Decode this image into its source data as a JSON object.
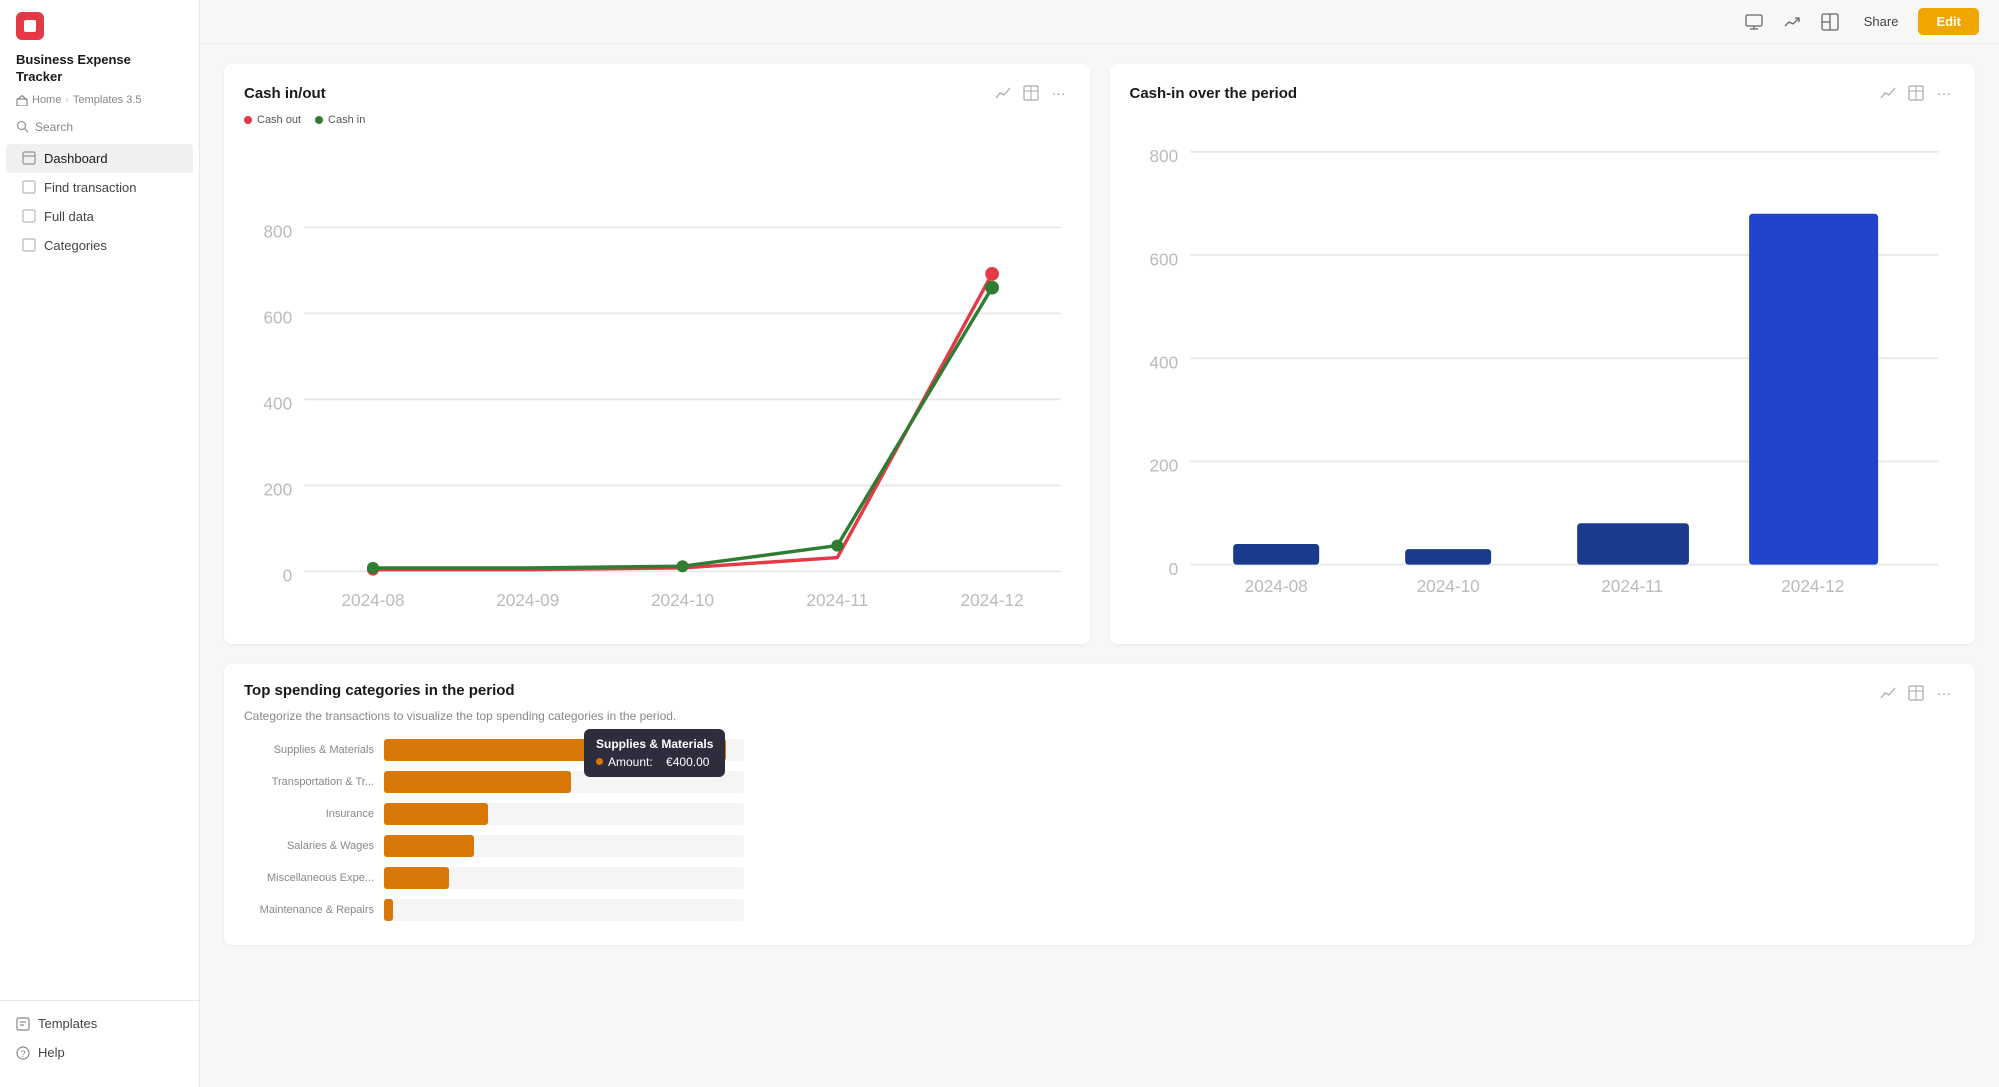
{
  "sidebar": {
    "app_title_line1": "Business Expense",
    "app_title_line2": "Tracker",
    "breadcrumb": {
      "home": "Home",
      "separator": "Templates 3.5"
    },
    "search_label": "Search",
    "nav_items": [
      {
        "id": "dashboard",
        "label": "Dashboard",
        "active": true
      },
      {
        "id": "find-transaction",
        "label": "Find transaction",
        "active": false
      },
      {
        "id": "full-data",
        "label": "Full data",
        "active": false
      },
      {
        "id": "categories",
        "label": "Categories",
        "active": false
      }
    ],
    "bottom_items": [
      {
        "id": "templates",
        "label": "Templates"
      },
      {
        "id": "help",
        "label": "Help"
      }
    ]
  },
  "topbar": {
    "share_label": "Share",
    "edit_label": "Edit"
  },
  "charts": {
    "cash_inout": {
      "title": "Cash in/out",
      "legend_out": "Cash out",
      "legend_in": "Cash in",
      "x_labels": [
        "2024-08",
        "2024-09",
        "2024-10",
        "2024-11",
        "2024-12"
      ],
      "y_labels": [
        "0",
        "200",
        "400",
        "600",
        "800"
      ],
      "cash_out_data": [
        5,
        5,
        8,
        30,
        695
      ],
      "cash_in_data": [
        8,
        8,
        10,
        60,
        660
      ]
    },
    "cash_in_period": {
      "title": "Cash-in over the period",
      "x_labels": [
        "2024-08",
        "2024-10",
        "2024-11",
        "2024-12"
      ],
      "y_labels": [
        "0",
        "200",
        "400",
        "600",
        "800"
      ],
      "bar_data": [
        {
          "label": "2024-08",
          "value": 40
        },
        {
          "label": "2024-10",
          "value": 30
        },
        {
          "label": "2024-11",
          "value": 80
        },
        {
          "label": "2024-12",
          "value": 680
        }
      ],
      "max_value": 800
    }
  },
  "spending": {
    "title": "Top spending categories in the period",
    "description": "Categorize the transactions to visualize the top spending categories in the period.",
    "categories": [
      {
        "label": "Supplies & Materials",
        "value": 400,
        "max": 420
      },
      {
        "label": "Transportation & Tr...",
        "value": 220,
        "max": 420
      },
      {
        "label": "Insurance",
        "value": 120,
        "max": 420
      },
      {
        "label": "Salaries & Wages",
        "value": 105,
        "max": 420
      },
      {
        "label": "Miscellaneous Expe...",
        "value": 75,
        "max": 420
      },
      {
        "label": "Maintenance & Repairs",
        "value": 10,
        "max": 420
      }
    ],
    "tooltip": {
      "title": "Supplies & Materials",
      "amount_label": "Amount:",
      "amount_value": "€400.00"
    }
  }
}
